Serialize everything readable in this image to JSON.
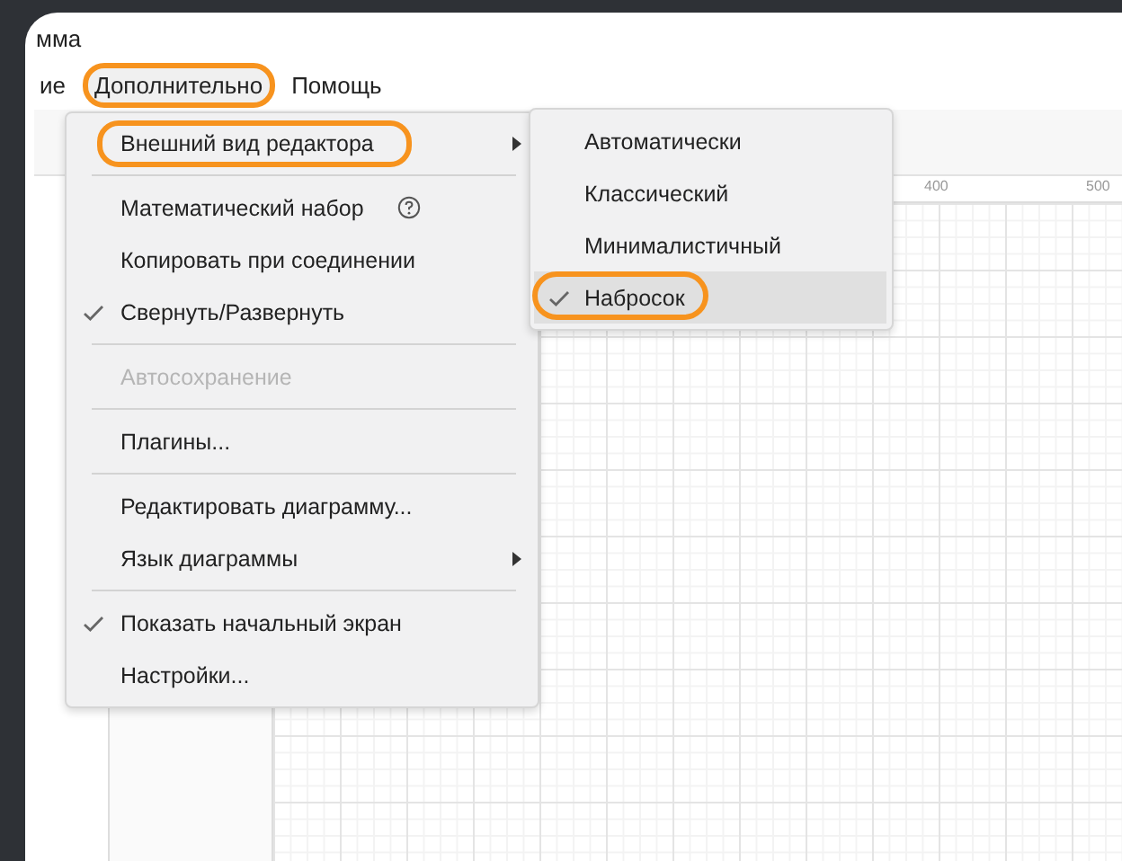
{
  "window": {
    "title": "мма"
  },
  "menubar": [
    {
      "label": "ие",
      "selected": false,
      "circled": false
    },
    {
      "label": "Дополнительно",
      "selected": true,
      "circled": true
    },
    {
      "label": "Помощь",
      "selected": false,
      "circled": false
    }
  ],
  "ruler": {
    "labels": [
      "400",
      "500"
    ]
  },
  "menu": [
    {
      "kind": "item",
      "label": "Внешний вид редактора",
      "submenu": true,
      "circled": true,
      "checked": false,
      "disabled": false,
      "help": false
    },
    {
      "kind": "separator"
    },
    {
      "kind": "item",
      "label": "Математический набор",
      "submenu": false,
      "circled": false,
      "checked": false,
      "disabled": false,
      "help": true
    },
    {
      "kind": "item",
      "label": "Копировать при соединении",
      "submenu": false,
      "circled": false,
      "checked": false,
      "disabled": false,
      "help": false
    },
    {
      "kind": "item",
      "label": "Свернуть/Развернуть",
      "submenu": false,
      "circled": false,
      "checked": true,
      "disabled": false,
      "help": false
    },
    {
      "kind": "separator"
    },
    {
      "kind": "item",
      "label": "Автосохранение",
      "submenu": false,
      "circled": false,
      "checked": false,
      "disabled": true,
      "help": false
    },
    {
      "kind": "separator"
    },
    {
      "kind": "item",
      "label": "Плагины...",
      "submenu": false,
      "circled": false,
      "checked": false,
      "disabled": false,
      "help": false
    },
    {
      "kind": "separator"
    },
    {
      "kind": "item",
      "label": "Редактировать диаграмму...",
      "submenu": false,
      "circled": false,
      "checked": false,
      "disabled": false,
      "help": false
    },
    {
      "kind": "item",
      "label": "Язык диаграммы",
      "submenu": true,
      "circled": false,
      "checked": false,
      "disabled": false,
      "help": false
    },
    {
      "kind": "separator"
    },
    {
      "kind": "item",
      "label": "Показать начальный экран",
      "submenu": false,
      "circled": false,
      "checked": true,
      "disabled": false,
      "help": false
    },
    {
      "kind": "item",
      "label": "Настройки...",
      "submenu": false,
      "circled": false,
      "checked": false,
      "disabled": false,
      "help": false
    }
  ],
  "submenu": [
    {
      "label": "Автоматически",
      "checked": false,
      "selected": false,
      "circled": false
    },
    {
      "label": "Классический",
      "checked": false,
      "selected": false,
      "circled": false
    },
    {
      "label": "Минималистичный",
      "checked": false,
      "selected": false,
      "circled": false
    },
    {
      "label": "Набросок",
      "checked": true,
      "selected": true,
      "circled": true
    }
  ]
}
